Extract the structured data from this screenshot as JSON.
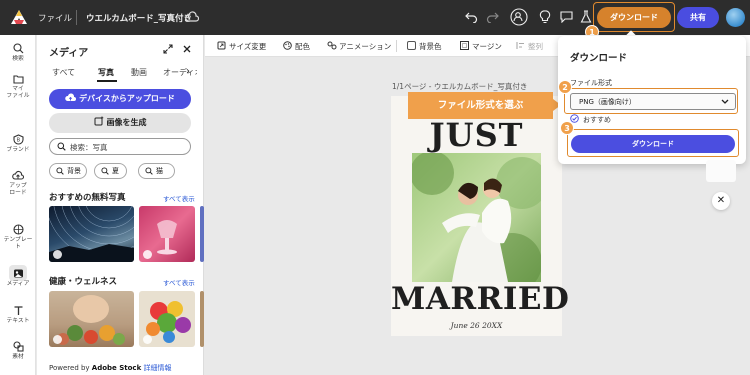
{
  "topbar": {
    "file_menu": "ファイル",
    "doc_title": "ウエルカムボード_写真付き",
    "download_label": "ダウンロード",
    "share_label": "共有",
    "icons": [
      "undo-icon",
      "redo-icon",
      "add-user-icon",
      "bulb-icon",
      "comment-icon",
      "flask-icon"
    ]
  },
  "rail": {
    "items": [
      {
        "label": "検索",
        "icon": "search-icon"
      },
      {
        "label": "マイ\nファイル",
        "icon": "folder-icon"
      },
      {
        "label": "ブランド",
        "icon": "brand-icon"
      },
      {
        "label": "アップ\nロード",
        "icon": "upload-cloud-icon"
      },
      {
        "label": "テンプレー\nト",
        "icon": "template-icon"
      },
      {
        "label": "メディア",
        "icon": "media-icon"
      },
      {
        "label": "テキスト",
        "icon": "text-icon"
      },
      {
        "label": "素材",
        "icon": "shapes-icon"
      }
    ]
  },
  "panel": {
    "title": "メディア",
    "tabs": [
      "すべて",
      "写真",
      "動画",
      "オーディオ"
    ],
    "active_tab": "写真",
    "upload_button": "デバイスからアップロード",
    "generate_button": "画像を生成",
    "search_value": "検索：写真",
    "chips": [
      "背景",
      "夏",
      "猫"
    ],
    "section1": {
      "title": "おすすめの無料写真",
      "see_all": "すべて表示"
    },
    "section2": {
      "title": "健康・ウェルネス",
      "see_all": "すべて表示"
    },
    "powered_prefix": "Powered by ",
    "powered_brand": "Adobe Stock",
    "powered_link": "詳細情報"
  },
  "toolbar": {
    "resize": "サイズ変更",
    "color": "配色",
    "animation": "アニメーション",
    "background_color": "背景色",
    "margin": "マージン",
    "arrange": "整列"
  },
  "canvas": {
    "page_label": "1/1ページ - ウエルカムボード_写真付き",
    "card_top": "JUST",
    "card_bottom": "MARRIED",
    "card_date": "June 26 20XX"
  },
  "callout": {
    "text": "ファイル形式を選ぶ"
  },
  "download_popover": {
    "title": "ダウンロード",
    "format_label": "ファイル形式",
    "format_value": "PNG（画像向け）",
    "recommended": "おすすめ",
    "download_button": "ダウンロード"
  },
  "steps": [
    "1",
    "2",
    "3"
  ],
  "colors": {
    "accent_orange": "#f0a04b",
    "primary_blue": "#4b4ee0",
    "topbar": "#2d2d2d"
  }
}
